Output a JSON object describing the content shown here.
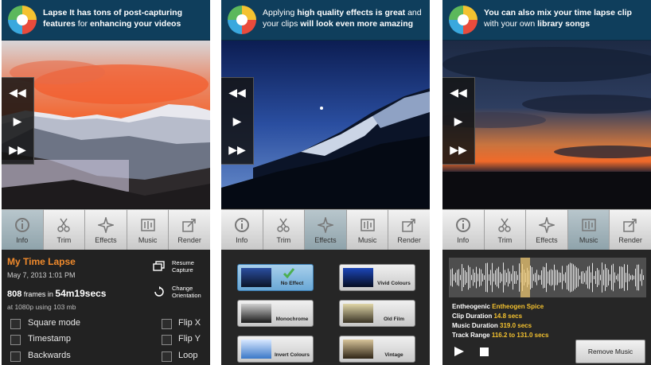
{
  "screens": [
    {
      "header": {
        "pre": "Lapse It has tons of ",
        "bold1": "post-capturing",
        "mid": " features",
        "mid2": " for ",
        "bold2": "enhancing your videos"
      },
      "info": {
        "title": "My Time Lapse",
        "date": "May 7, 2013 1:01 PM",
        "frames_count": "808",
        "frames_word": "frames in",
        "duration": "54m19secs",
        "resolution": "at 1080p using 103 mb",
        "resume": "Resume Capture",
        "orientation": "Change Orientation",
        "options": [
          "Square mode",
          "Flip X",
          "Timestamp",
          "Flip Y",
          "Backwards",
          "Loop"
        ]
      }
    },
    {
      "header": {
        "pre": "Applying ",
        "bold1": "high quality effects is great",
        "mid": " and your clips ",
        "bold2": "will look even more amazing"
      },
      "effects": [
        "No Effect",
        "Vivid Colours",
        "Monochrome",
        "Old Film",
        "Invert Colours",
        "Vintage"
      ]
    },
    {
      "header": {
        "bold1": "You can also mix your time lapse clip",
        "mid": " with your own ",
        "bold2": "library songs"
      },
      "music": {
        "song_artist": "Entheogenic",
        "song_title": "Entheogen Spice",
        "clip_label": "Clip Duration",
        "clip_value": "14.8 secs",
        "music_label": "Music Duration",
        "music_value": "319.0 secs",
        "range_label": "Track Range",
        "range_value": "116.2 to 131.0 secs",
        "remove_label": "Remove Music"
      }
    }
  ],
  "tabs": [
    "Info",
    "Trim",
    "Effects",
    "Music",
    "Render"
  ],
  "controls": [
    "◀◀",
    "▶",
    "▶▶"
  ]
}
